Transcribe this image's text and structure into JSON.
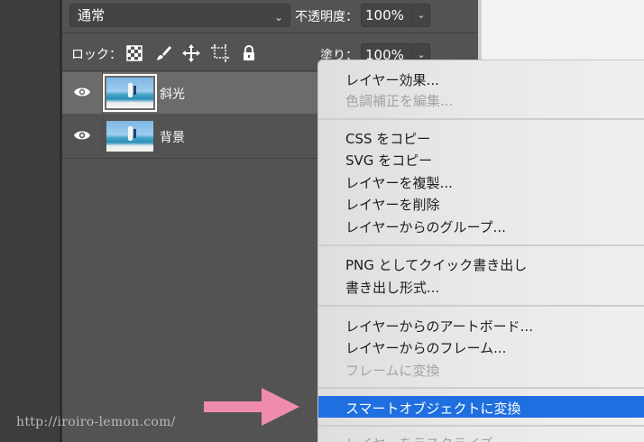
{
  "blend": {
    "mode": "通常",
    "opacity_label": "不透明度：",
    "opacity_value": "100%"
  },
  "lock": {
    "label": "ロック：",
    "icons": [
      "transparent-pixels-lock-icon",
      "brush-lock-icon",
      "move-lock-icon",
      "artboard-lock-icon",
      "padlock-icon"
    ],
    "fill_label": "塗り：",
    "fill_value": "100%"
  },
  "layers": [
    {
      "name": "斜光",
      "selected": true,
      "visible": true
    },
    {
      "name": "背景",
      "selected": false,
      "visible": true
    }
  ],
  "context_menu": {
    "items": [
      {
        "label": "レイヤー効果...",
        "enabled": true
      },
      {
        "label": "色調補正を編集...",
        "enabled": false
      },
      {
        "label": "CSS をコピー",
        "enabled": true
      },
      {
        "label": "SVG をコピー",
        "enabled": true
      },
      {
        "label": "レイヤーを複製...",
        "enabled": true
      },
      {
        "label": "レイヤーを削除",
        "enabled": true
      },
      {
        "label": "レイヤーからのグループ...",
        "enabled": true
      },
      {
        "label": "PNG としてクイック書き出し",
        "enabled": true
      },
      {
        "label": "書き出し形式...",
        "enabled": true
      },
      {
        "label": "レイヤーからのアートボード...",
        "enabled": true
      },
      {
        "label": "レイヤーからのフレーム...",
        "enabled": true
      },
      {
        "label": "フレームに変換",
        "enabled": false
      },
      {
        "label": "スマートオブジェクトに変換",
        "enabled": true,
        "highlighted": true
      },
      {
        "label": "レイヤーをラスタライズ",
        "enabled": false
      }
    ],
    "highlight_color": "#1f6fe0"
  },
  "overlay": {
    "watermark": "http://iroiro-lemon.com/",
    "arrow_color": "#f08bb0"
  }
}
